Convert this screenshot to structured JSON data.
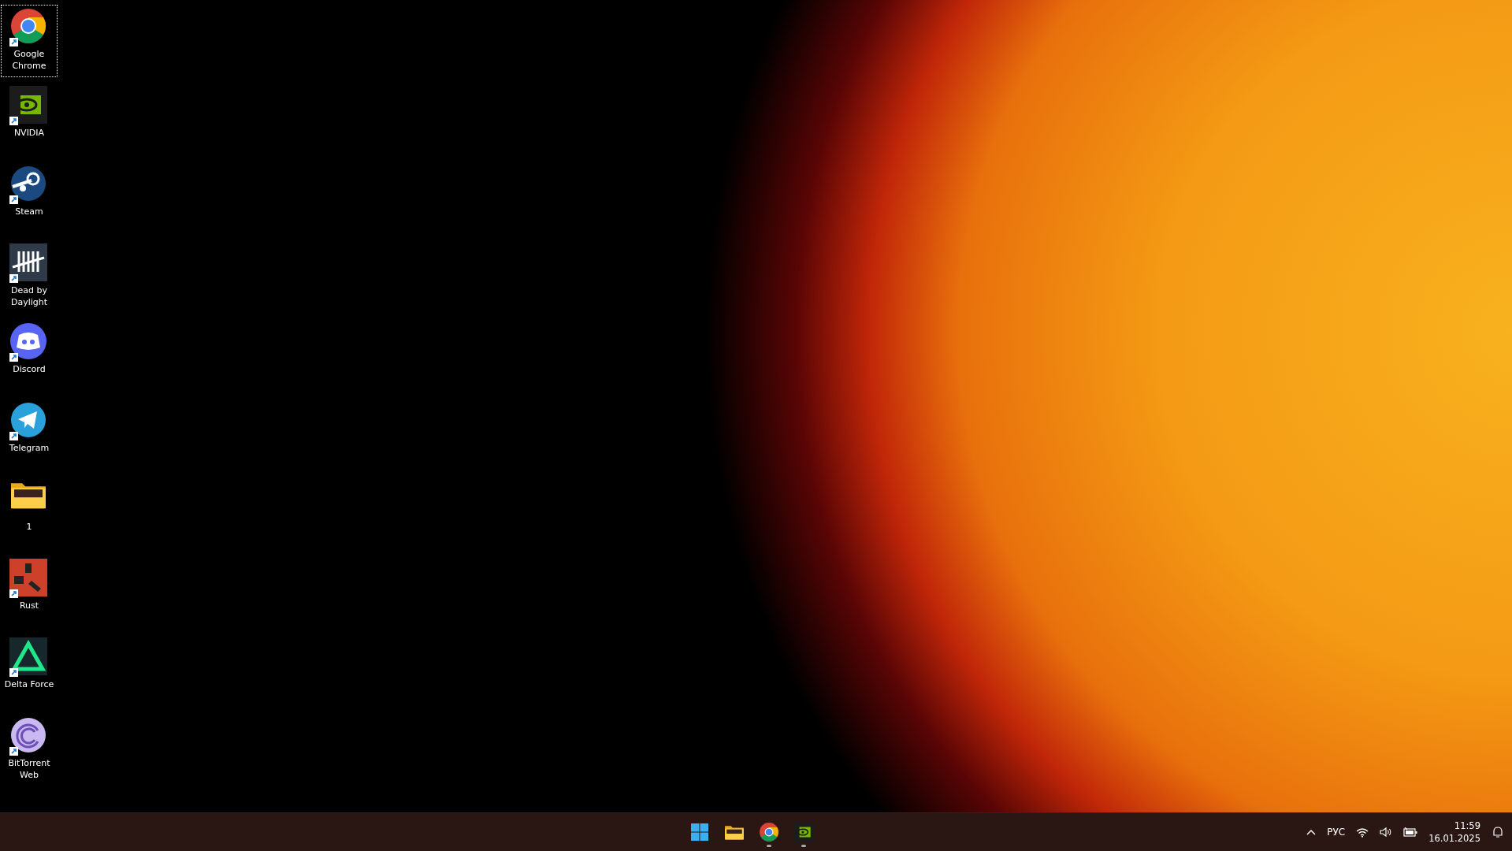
{
  "desktop_icons": [
    {
      "label": "Google Chrome",
      "kind": "chrome",
      "selected": true,
      "shortcut": true
    },
    {
      "label": "NVIDIA",
      "kind": "nvidia",
      "selected": false,
      "shortcut": true
    },
    {
      "label": "Steam",
      "kind": "steam",
      "selected": false,
      "shortcut": true
    },
    {
      "label": "Dead by Daylight",
      "kind": "tally",
      "selected": false,
      "shortcut": true
    },
    {
      "label": "Discord",
      "kind": "discord",
      "selected": false,
      "shortcut": true
    },
    {
      "label": "Telegram",
      "kind": "telegram",
      "selected": false,
      "shortcut": true
    },
    {
      "label": "1",
      "kind": "folder",
      "selected": false,
      "shortcut": false
    },
    {
      "label": "Rust",
      "kind": "rust",
      "selected": false,
      "shortcut": true
    },
    {
      "label": "Delta Force",
      "kind": "delta",
      "selected": false,
      "shortcut": true
    },
    {
      "label": "BitTorrent Web",
      "kind": "torrent",
      "selected": false,
      "shortcut": true
    }
  ],
  "taskbar": {
    "apps": [
      {
        "kind": "start",
        "running": false
      },
      {
        "kind": "folder",
        "running": false
      },
      {
        "kind": "chrome",
        "running": true
      },
      {
        "kind": "nvidia",
        "running": true
      }
    ],
    "tray": {
      "language": "РУС",
      "time": "11:59",
      "date": "16.01.2025"
    }
  }
}
